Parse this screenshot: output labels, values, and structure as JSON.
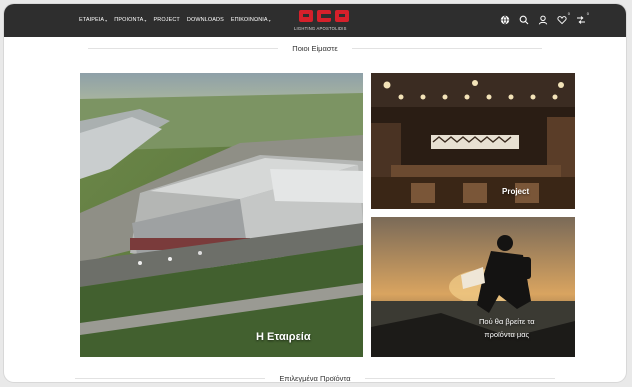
{
  "nav": {
    "items": [
      {
        "label": "ΕΤΑΙΡΕΙΑ",
        "dropdown": true
      },
      {
        "label": "ΠΡΟΙΟΝΤΑ",
        "dropdown": true
      },
      {
        "label": "PROJECT",
        "dropdown": false
      },
      {
        "label": "DOWNLOADS",
        "dropdown": false
      },
      {
        "label": "ΕΠΙΚΟΙΝΩΝΙΑ",
        "dropdown": true
      }
    ],
    "icons": [
      "globe-icon",
      "search-icon",
      "user-icon",
      "heart-icon",
      "compare-icon"
    ],
    "badges": {
      "heart": "0",
      "compare": "0"
    }
  },
  "logo": {
    "mark": "aca",
    "subtitle": "LIGHTING APOSTOLIDIS",
    "color": "#d6202b"
  },
  "sections": {
    "about_title": "Ποιοι Είμαστε",
    "featured_title": "Επιλεγμένα Προϊόντα"
  },
  "tiles": {
    "company": "Η Εταιρεία",
    "project": "Project",
    "where_line1": "Πού θα βρείτε τα",
    "where_line2": "προϊόντα μας"
  }
}
